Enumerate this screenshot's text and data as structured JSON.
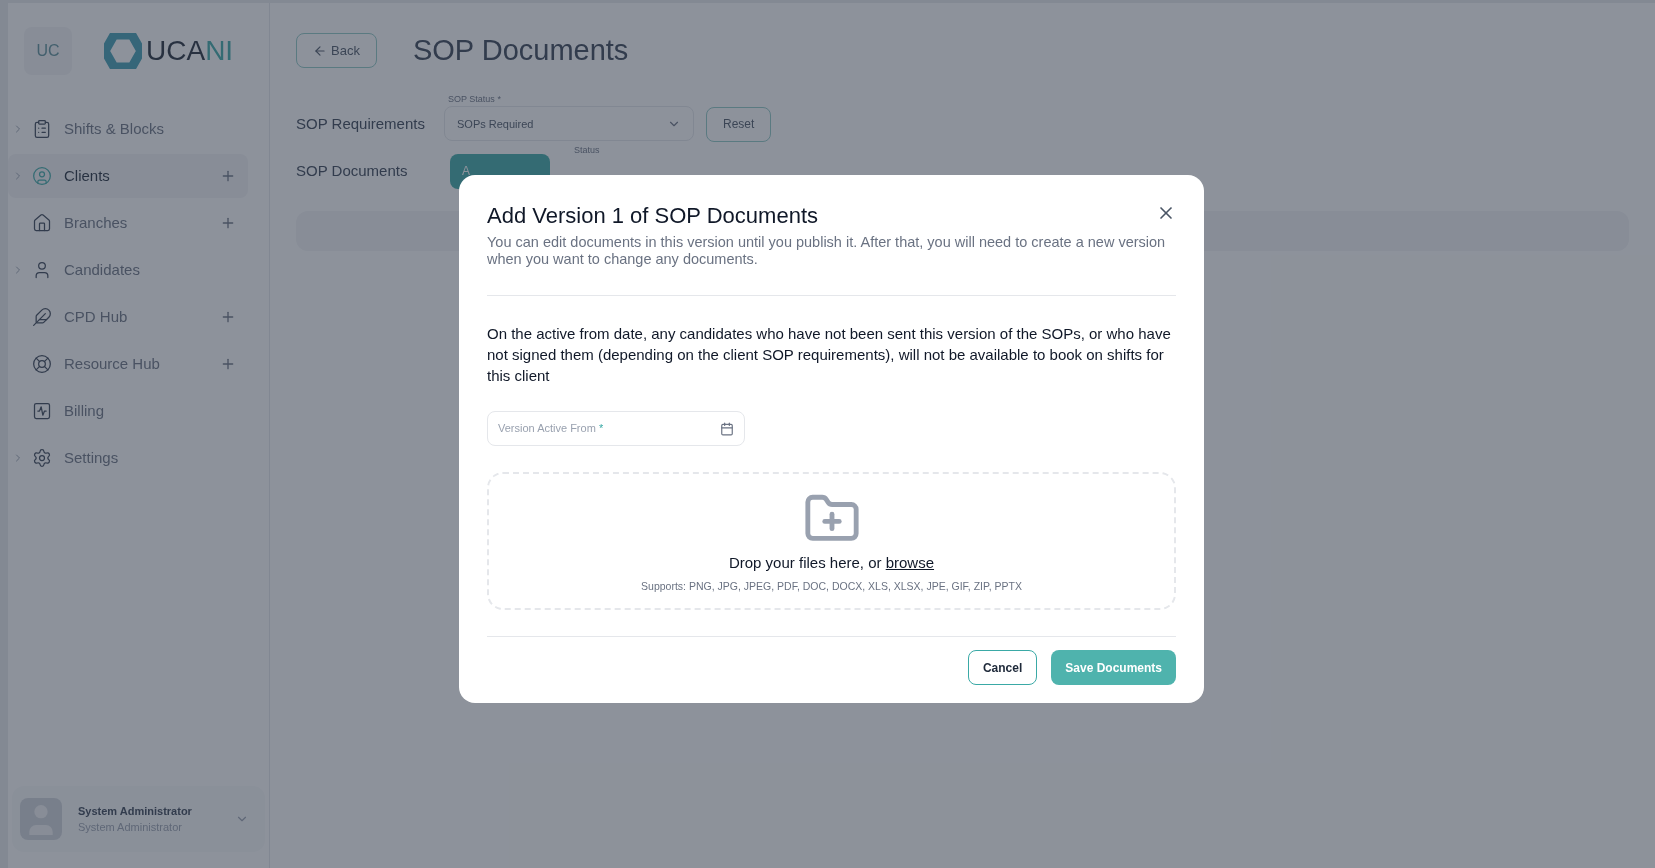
{
  "sidebar": {
    "avatar": "UC",
    "logo": {
      "part_1": "UCA",
      "part_2": "NI"
    },
    "items": [
      {
        "label": "Shifts & Blocks",
        "kind": "clipboard",
        "expandable": true,
        "addable": false,
        "selected": false
      },
      {
        "label": "Clients",
        "kind": "user-circle",
        "expandable": true,
        "addable": true,
        "selected": true
      },
      {
        "label": "Branches",
        "kind": "house",
        "expandable": false,
        "addable": true,
        "selected": false
      },
      {
        "label": "Candidates",
        "kind": "user",
        "expandable": true,
        "addable": false,
        "selected": false
      },
      {
        "label": "CPD Hub",
        "kind": "feather",
        "expandable": false,
        "addable": true,
        "selected": false
      },
      {
        "label": "Resource Hub",
        "kind": "lifebuoy",
        "expandable": false,
        "addable": true,
        "selected": false
      },
      {
        "label": "Billing",
        "kind": "chart",
        "expandable": false,
        "addable": false,
        "selected": false
      },
      {
        "label": "Settings",
        "kind": "gear",
        "expandable": true,
        "addable": false,
        "selected": false
      }
    ],
    "user": {
      "name": "System Administrator",
      "role": "System Administrator"
    }
  },
  "page": {
    "back": "Back",
    "title": "SOP Documents",
    "requirements": {
      "label": "SOP Requirements",
      "field_label": "SOP Status",
      "required_mark": "*",
      "value": "SOPs Required",
      "reset": "Reset"
    },
    "documents": {
      "label": "SOP Documents",
      "button": "A",
      "status_label": "Status"
    }
  },
  "modal": {
    "title": "Add Version 1 of SOP Documents",
    "subtitle": "You can edit documents in this version until you publish it. After that, you will need to create a new version when you want to change any documents.",
    "notice": "On the active from date, any candidates who have not been sent this version of the SOPs, or who have not signed them (depending on the client SOP requirements), will not be available to book on shifts for this client",
    "date_field": {
      "placeholder": "Version Active From",
      "required_mark": "*"
    },
    "dropzone": {
      "text": "Drop your files here, or",
      "link": "browse",
      "supports": "Supports: PNG, JPG, JPEG, PDF, DOC, DOCX, XLS, XLSX, JPE, GIF, ZIP, PPTX"
    },
    "buttons": {
      "cancel": "Cancel",
      "save": "Save Documents"
    }
  }
}
